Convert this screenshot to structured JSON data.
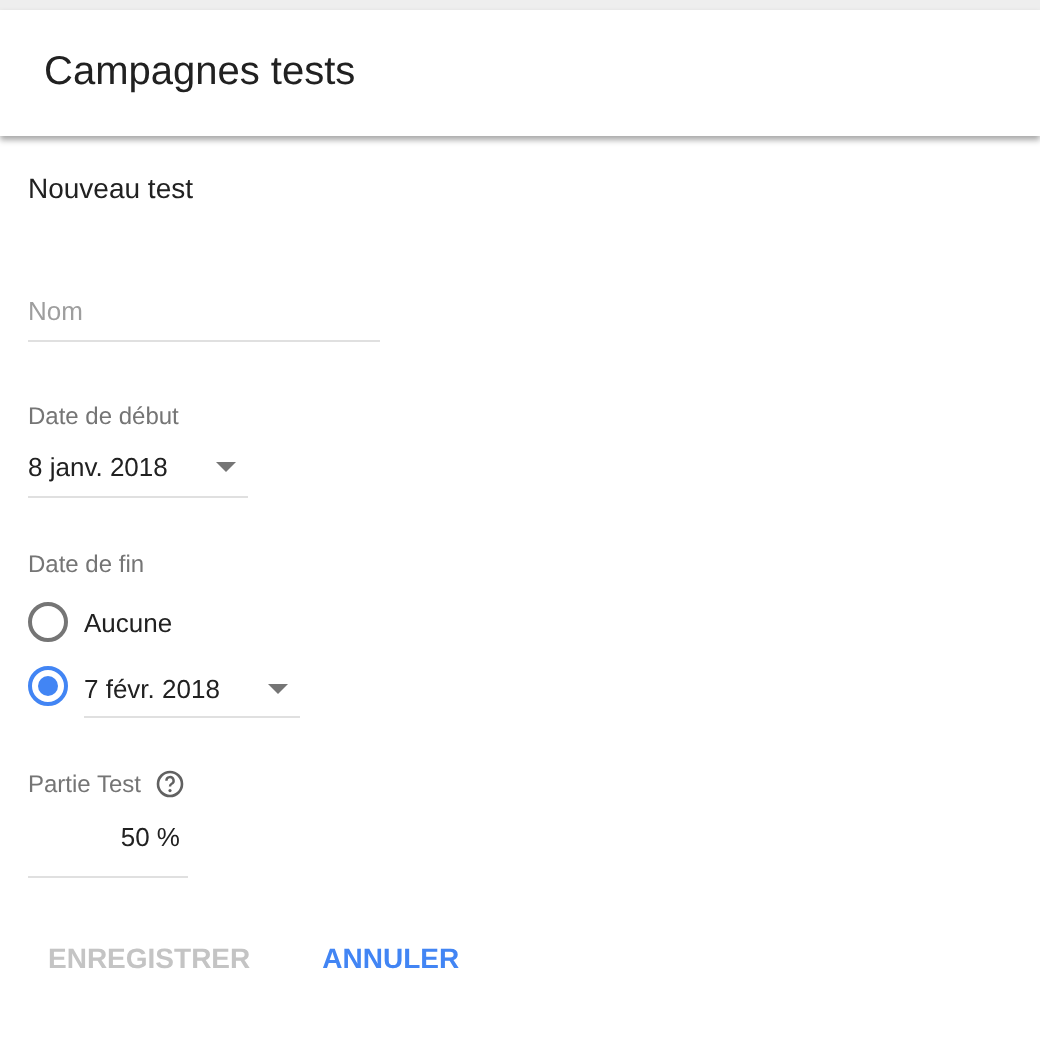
{
  "header": {
    "title": "Campagnes tests"
  },
  "form": {
    "title": "Nouveau test",
    "name_field": {
      "placeholder": "Nom"
    },
    "start_date": {
      "label": "Date de début",
      "value": "8 janv. 2018"
    },
    "end_date": {
      "label": "Date de fin",
      "options": [
        {
          "kind": "plain",
          "label": "Aucune",
          "selected": false
        },
        {
          "kind": "date",
          "value": "7 févr. 2018",
          "selected": true
        }
      ]
    },
    "test_share": {
      "label": "Partie Test",
      "value": "50 %"
    }
  },
  "buttons": [
    {
      "label": "ENREGISTRER",
      "disabled": true
    },
    {
      "label": "ANNULER",
      "disabled": false
    }
  ]
}
